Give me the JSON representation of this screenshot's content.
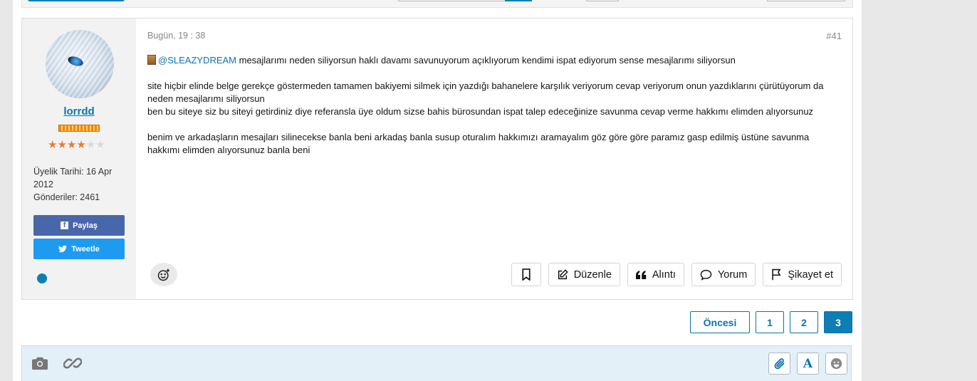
{
  "post": {
    "date": "Bugün, 19 : 38",
    "number": "#41",
    "author": {
      "username": "lorrdd",
      "stars_filled": 4,
      "stars_total": 6,
      "joined_label": "Üyelik Tarihi: 16 Apr 2012",
      "posts_label": "Gönderiler: 2461",
      "share_facebook": "Paylaş",
      "share_twitter": "Tweetle",
      "online": true
    },
    "body": {
      "mention": "@SLEAZYDREAM",
      "line1": " mesajlarımı neden siliyorsun haklı davamı savunuyorum açıklıyorum kendimi ispat ediyorum sense mesajlarımı siliyorsun",
      "para2a": "site hiçbir elinde belge gerekçe göstermeden tamamen bakiyemi silmek için yazdığı bahanelere karşılık veriyorum cevap veriyorum onun yazdıklarını çürütüyorum da neden mesajlarımı siliyorsun",
      "para2b": "ben bu siteye siz bu siteyi getirdiniz diye referansla üye oldum sizse bahis bürosundan ispat talep edeceğinize savunma cevap verme hakkımı elimden alıyorsunuz",
      "para3": "benim ve arkadaşların mesajları silinecekse banla beni arkadaş banla susup oturalım hakkımızı aramayalım göz göre göre paramız gasp edilmiş üstüne savunma hakkımı elimden alıyorsunuz banla beni"
    },
    "actions": {
      "edit": "Düzenle",
      "quote": "Alıntı",
      "comment": "Yorum",
      "report": "Şikayet et"
    }
  },
  "pagination": {
    "prev": "Öncesi",
    "pages": [
      "1",
      "2",
      "3"
    ],
    "active": "3"
  },
  "colors": {
    "accent": "#0d7fb4",
    "link": "#0b73b0",
    "facebook": "#4867aa",
    "twitter": "#1d9bf0",
    "editor_bg": "#e3f0f7"
  },
  "icons": {
    "editor_left": [
      "camera-icon",
      "link-icon"
    ],
    "editor_right": [
      "attachment-icon",
      "font-format-icon",
      "emoji-icon"
    ]
  }
}
